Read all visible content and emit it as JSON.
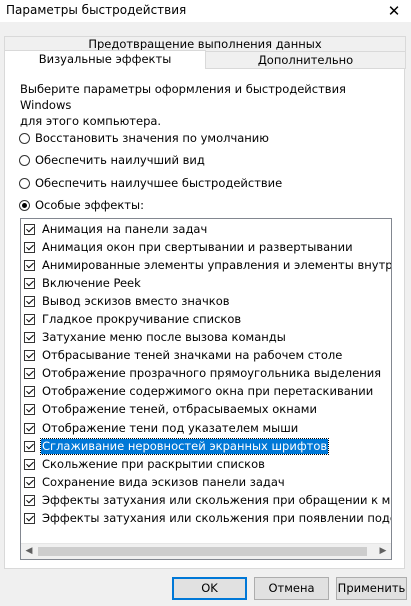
{
  "window": {
    "title": "Параметры быстродействия",
    "close_glyph": "✕"
  },
  "tabs": {
    "back": "Предотвращение выполнения данных",
    "visual": "Визуальные эффекты",
    "advanced": "Дополнительно"
  },
  "description": "Выберите параметры оформления и быстродействия Windows\nдля этого компьютера.",
  "radios": [
    {
      "label": "Восстановить значения по умолчанию",
      "checked": false
    },
    {
      "label": "Обеспечить наилучший вид",
      "checked": false
    },
    {
      "label": "Обеспечить наилучшее быстродействие",
      "checked": false
    },
    {
      "label": "Особые эффекты:",
      "checked": true
    }
  ],
  "effects": [
    {
      "label": "Анимация на панели задач",
      "checked": true
    },
    {
      "label": "Анимация окон при свертывании и развертывании",
      "checked": true
    },
    {
      "label": "Анимированные элементы управления и элементы внутри окн",
      "checked": true
    },
    {
      "label": "Включение Peek",
      "checked": true
    },
    {
      "label": "Вывод эскизов вместо значков",
      "checked": true
    },
    {
      "label": "Гладкое прокручивание списков",
      "checked": true
    },
    {
      "label": "Затухание меню после вызова команды",
      "checked": true
    },
    {
      "label": "Отбрасывание теней значками на рабочем столе",
      "checked": true
    },
    {
      "label": "Отображение прозрачного прямоугольника выделения",
      "checked": true
    },
    {
      "label": "Отображение содержимого окна при перетаскивании",
      "checked": true
    },
    {
      "label": "Отображение теней, отбрасываемых окнами",
      "checked": true
    },
    {
      "label": "Отображение тени под указателем мыши",
      "checked": true
    },
    {
      "label": "Сглаживание неровностей экранных шрифтов",
      "checked": true,
      "selected": true
    },
    {
      "label": "Скольжение при раскрытии списков",
      "checked": true
    },
    {
      "label": "Сохранение вида эскизов панели задач",
      "checked": true
    },
    {
      "label": "Эффекты затухания или скольжения при обращении к меню",
      "checked": true
    },
    {
      "label": "Эффекты затухания или скольжения при появлении подсказок",
      "checked": true
    }
  ],
  "scrollbar": {
    "left_glyph": "◀",
    "right_glyph": "▶"
  },
  "buttons": {
    "ok": "OK",
    "cancel": "Отмена",
    "apply": "Применить"
  },
  "colors": {
    "selection": "#0078d7",
    "default_button_border": "#0078d7"
  }
}
